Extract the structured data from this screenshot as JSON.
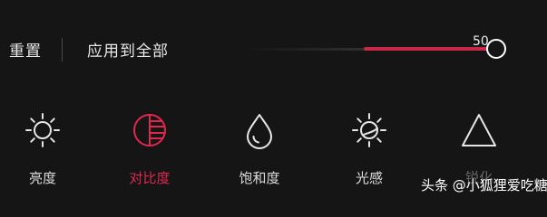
{
  "toolbar": {
    "reset_label": "重置",
    "apply_all_label": "应用到全部"
  },
  "slider": {
    "value": "50",
    "level_fraction": 1.0,
    "fill_color": "#c8274a"
  },
  "tools": [
    {
      "label": "亮度",
      "icon": "brightness-icon",
      "active": false
    },
    {
      "label": "对比度",
      "icon": "contrast-icon",
      "active": true
    },
    {
      "label": "饱和度",
      "icon": "saturation-drop-icon",
      "active": false
    },
    {
      "label": "光感",
      "icon": "light-sense-icon",
      "active": false
    },
    {
      "label": "锐化",
      "icon": "sharpen-triangle-icon",
      "active": false
    }
  ],
  "colors": {
    "accent": "#e0284f",
    "background": "#151515",
    "text": "#e6e6e6"
  },
  "watermark": {
    "text": "头条 @小狐狸爱吃糖"
  }
}
